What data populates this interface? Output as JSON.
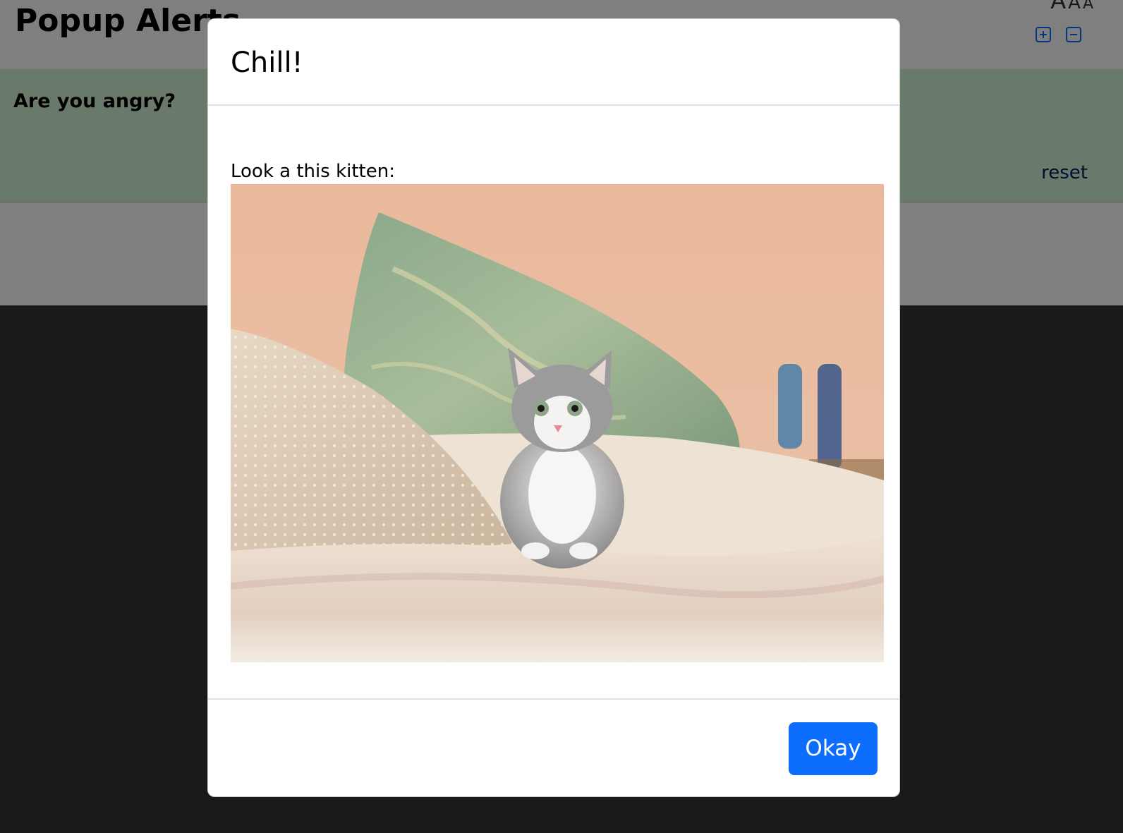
{
  "page": {
    "title": "Popup Alerts",
    "font_size_controls": {
      "letters": [
        "A",
        "A",
        "A"
      ],
      "zoom_in_icon": "plus-square-icon",
      "zoom_out_icon": "minus-square-icon"
    }
  },
  "question_panel": {
    "question": "Are you angry?",
    "reset_label": "reset"
  },
  "modal": {
    "title": "Chill!",
    "body_text": "Look a this kitten:",
    "image": "kitten-photo",
    "okay_label": "Okay"
  },
  "colors": {
    "primary_button": "#0d6efd",
    "question_panel_bg": "#d4f4d4",
    "link": "#001a66"
  }
}
